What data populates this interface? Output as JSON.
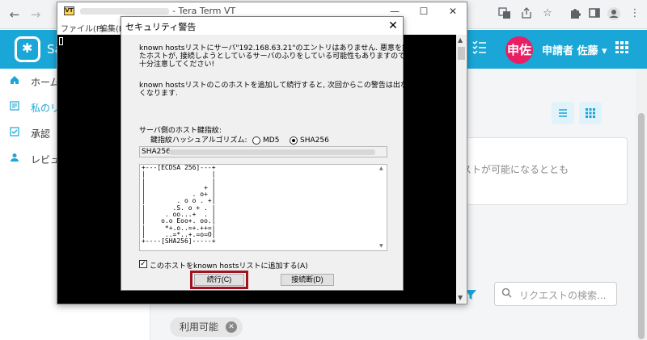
{
  "browser": {
    "back_icon": "←",
    "forward_icon": "→",
    "translate_icon": "translate-icon",
    "share_icon": "share-icon",
    "star_icon": "star-icon",
    "extensions_icon": "puzzle-icon",
    "sidepanel_icon": "sidepanel-icon",
    "profile_icon": "profile-icon",
    "menu_icon": "⋮",
    "window_min": "—",
    "window_max": "☐",
    "window_close": "✕"
  },
  "app": {
    "brand_fragment": "Sa",
    "avatar_text": "申佐",
    "user_name": "申請者 佐藤 ▾",
    "accent_color": "#1aa6d6",
    "avatar_color": "#e91e63"
  },
  "sidebar": {
    "items": [
      {
        "label": "ホーム",
        "icon": "home-icon"
      },
      {
        "label": "私のリ",
        "icon": "list-icon"
      },
      {
        "label": "承認",
        "icon": "approve-icon"
      },
      {
        "label": "レビュ",
        "icon": "user-icon"
      }
    ]
  },
  "main": {
    "info_text": "エストが可能になるととも",
    "search_placeholder": "リクエストの検索...",
    "chip_label": "利用可能"
  },
  "teraterm": {
    "title": "- Tera Term VT",
    "icon_text": "VT",
    "menu": [
      "ファイル(F)",
      "編集(E"
    ],
    "ctrl_min": "—",
    "ctrl_max": "☐",
    "ctrl_close": "✕"
  },
  "dialog": {
    "title": "セキュリティ警告",
    "close": "✕",
    "message1": [
      "known hostsリストにサーバ\"192.168.63.21\"のエントリはありません. 悪意を持っ",
      "たホストが, 接続しようとしているサーバのふりをしている可能性もありますので,",
      "十分注意してください!"
    ],
    "message2": [
      "known hostsリストのこのホストを追加して続行すると, 次回からこの警告は出な",
      "くなります."
    ],
    "fingerprint_label": "サーバ側のホスト鍵指紋:",
    "hash_label": "鍵指紋ハッシュアルゴリズム:",
    "hash_options": [
      "MD5",
      "SHA256"
    ],
    "hash_selected": "SHA256",
    "fingerprint_prefix": "SHA256",
    "randomart": "+---[ECDSA 256]---+\n|                 |\n|                 |\n|               + |\n|            . o+ |\n|        . o o . +|\n|       .S. o + . |\n|     . oo...+  . |\n|    o.o Eoo+. oo.|\n|     *+.o..=+.++=|\n|     ..=*..+.=o=O|\n+----[SHA256]-----+",
    "checkbox_checked": true,
    "checkbox_label": "このホストをknown hostsリストに追加する(A)",
    "continue_button": "続行(C)",
    "disconnect_button": "接続断(D)",
    "highlight_color": "#a0141e"
  }
}
